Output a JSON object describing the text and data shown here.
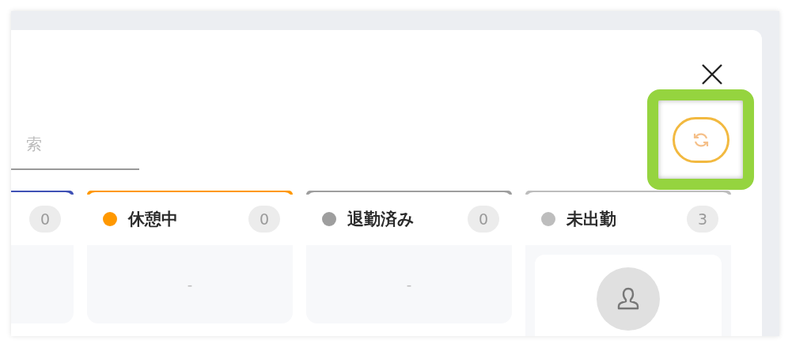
{
  "search": {
    "placeholder": "索"
  },
  "columns": [
    {
      "color": "#3f51b5",
      "count": "0",
      "kind": "empty"
    },
    {
      "color": "#ff9800",
      "title": "休憩中",
      "count": "0",
      "kind": "empty",
      "empty_text": "-"
    },
    {
      "color": "#9e9e9e",
      "title": "退勤済み",
      "count": "0",
      "kind": "empty",
      "empty_text": "-"
    },
    {
      "color": "#bdbdbd",
      "title": "未出勤",
      "count": "3",
      "kind": "cards",
      "cards": [
        {
          "kind": "person"
        }
      ]
    }
  ]
}
